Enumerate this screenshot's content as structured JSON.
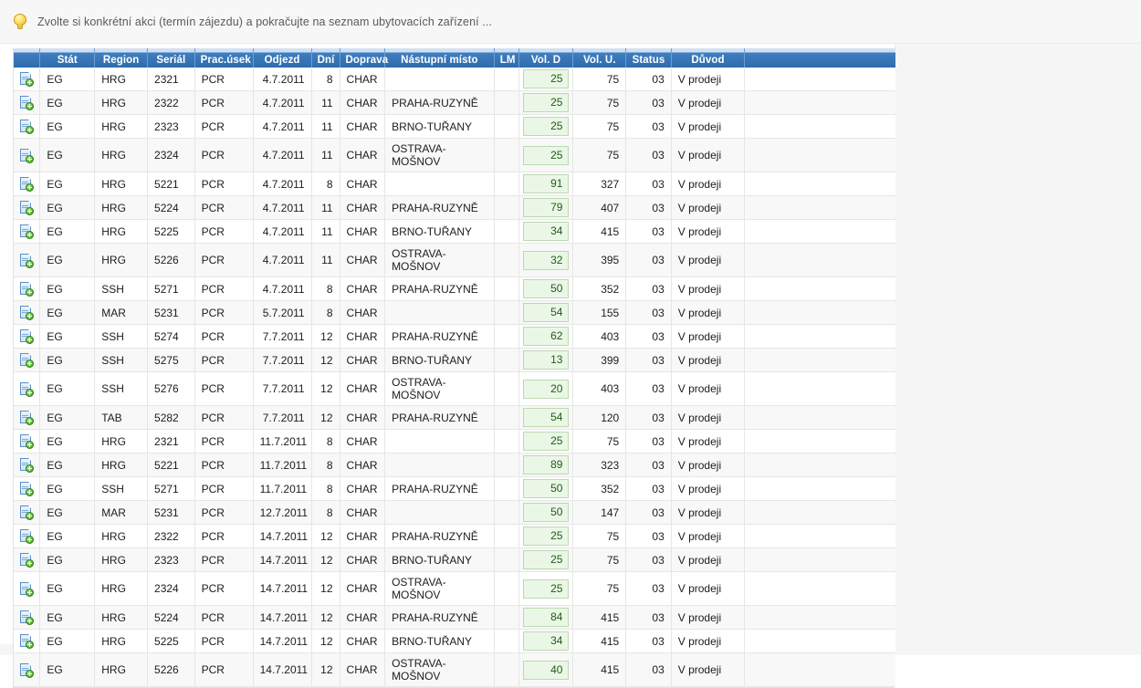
{
  "hint": {
    "icon": "lightbulb-icon",
    "text": "Zvolte si konkrétní akci (termín zájezdu) a pokračujte na seznam ubytovacích zařízení ..."
  },
  "grid": {
    "row_icon": "document-add-icon",
    "columns": [
      {
        "key": "icon",
        "label": ""
      },
      {
        "key": "stat",
        "label": "Stát"
      },
      {
        "key": "region",
        "label": "Region"
      },
      {
        "key": "serial",
        "label": "Seriál"
      },
      {
        "key": "usek",
        "label": "Prac.úsek"
      },
      {
        "key": "odjezd",
        "label": "Odjezd"
      },
      {
        "key": "dni",
        "label": "Dní"
      },
      {
        "key": "doprava",
        "label": "Doprava"
      },
      {
        "key": "nastup",
        "label": "Nástupní místo"
      },
      {
        "key": "lm",
        "label": "LM"
      },
      {
        "key": "vold",
        "label": "Vol. D"
      },
      {
        "key": "volu",
        "label": "Vol. U."
      },
      {
        "key": "status",
        "label": "Status"
      },
      {
        "key": "duvod",
        "label": "Důvod"
      },
      {
        "key": "extra",
        "label": ""
      }
    ],
    "rows": [
      {
        "stat": "EG",
        "region": "HRG",
        "serial": "2321",
        "usek": "PCR",
        "odjezd": "4.7.2011",
        "dni": "8",
        "doprava": "CHAR",
        "nastup": "",
        "lm": "",
        "vold": "25",
        "volu": "75",
        "status": "03",
        "duvod": "V prodeji",
        "extra": ""
      },
      {
        "stat": "EG",
        "region": "HRG",
        "serial": "2322",
        "usek": "PCR",
        "odjezd": "4.7.2011",
        "dni": "11",
        "doprava": "CHAR",
        "nastup": "PRAHA-RUZYNĚ",
        "lm": "",
        "vold": "25",
        "volu": "75",
        "status": "03",
        "duvod": "V prodeji",
        "extra": ""
      },
      {
        "stat": "EG",
        "region": "HRG",
        "serial": "2323",
        "usek": "PCR",
        "odjezd": "4.7.2011",
        "dni": "11",
        "doprava": "CHAR",
        "nastup": "BRNO-TUŘANY",
        "lm": "",
        "vold": "25",
        "volu": "75",
        "status": "03",
        "duvod": "V prodeji",
        "extra": ""
      },
      {
        "stat": "EG",
        "region": "HRG",
        "serial": "2324",
        "usek": "PCR",
        "odjezd": "4.7.2011",
        "dni": "11",
        "doprava": "CHAR",
        "nastup": "OSTRAVA-MOŠNOV",
        "lm": "",
        "vold": "25",
        "volu": "75",
        "status": "03",
        "duvod": "V prodeji",
        "extra": ""
      },
      {
        "stat": "EG",
        "region": "HRG",
        "serial": "5221",
        "usek": "PCR",
        "odjezd": "4.7.2011",
        "dni": "8",
        "doprava": "CHAR",
        "nastup": "",
        "lm": "",
        "vold": "91",
        "volu": "327",
        "status": "03",
        "duvod": "V prodeji",
        "extra": ""
      },
      {
        "stat": "EG",
        "region": "HRG",
        "serial": "5224",
        "usek": "PCR",
        "odjezd": "4.7.2011",
        "dni": "11",
        "doprava": "CHAR",
        "nastup": "PRAHA-RUZYNĚ",
        "lm": "",
        "vold": "79",
        "volu": "407",
        "status": "03",
        "duvod": "V prodeji",
        "extra": ""
      },
      {
        "stat": "EG",
        "region": "HRG",
        "serial": "5225",
        "usek": "PCR",
        "odjezd": "4.7.2011",
        "dni": "11",
        "doprava": "CHAR",
        "nastup": "BRNO-TUŘANY",
        "lm": "",
        "vold": "34",
        "volu": "415",
        "status": "03",
        "duvod": "V prodeji",
        "extra": ""
      },
      {
        "stat": "EG",
        "region": "HRG",
        "serial": "5226",
        "usek": "PCR",
        "odjezd": "4.7.2011",
        "dni": "11",
        "doprava": "CHAR",
        "nastup": "OSTRAVA-MOŠNOV",
        "lm": "",
        "vold": "32",
        "volu": "395",
        "status": "03",
        "duvod": "V prodeji",
        "extra": ""
      },
      {
        "stat": "EG",
        "region": "SSH",
        "serial": "5271",
        "usek": "PCR",
        "odjezd": "4.7.2011",
        "dni": "8",
        "doprava": "CHAR",
        "nastup": "PRAHA-RUZYNĚ",
        "lm": "",
        "vold": "50",
        "volu": "352",
        "status": "03",
        "duvod": "V prodeji",
        "extra": ""
      },
      {
        "stat": "EG",
        "region": "MAR",
        "serial": "5231",
        "usek": "PCR",
        "odjezd": "5.7.2011",
        "dni": "8",
        "doprava": "CHAR",
        "nastup": "",
        "lm": "",
        "vold": "54",
        "volu": "155",
        "status": "03",
        "duvod": "V prodeji",
        "extra": ""
      },
      {
        "stat": "EG",
        "region": "SSH",
        "serial": "5274",
        "usek": "PCR",
        "odjezd": "7.7.2011",
        "dni": "12",
        "doprava": "CHAR",
        "nastup": "PRAHA-RUZYNĚ",
        "lm": "",
        "vold": "62",
        "volu": "403",
        "status": "03",
        "duvod": "V prodeji",
        "extra": ""
      },
      {
        "stat": "EG",
        "region": "SSH",
        "serial": "5275",
        "usek": "PCR",
        "odjezd": "7.7.2011",
        "dni": "12",
        "doprava": "CHAR",
        "nastup": "BRNO-TUŘANY",
        "lm": "",
        "vold": "13",
        "volu": "399",
        "status": "03",
        "duvod": "V prodeji",
        "extra": ""
      },
      {
        "stat": "EG",
        "region": "SSH",
        "serial": "5276",
        "usek": "PCR",
        "odjezd": "7.7.2011",
        "dni": "12",
        "doprava": "CHAR",
        "nastup": "OSTRAVA-MOŠNOV",
        "lm": "",
        "vold": "20",
        "volu": "403",
        "status": "03",
        "duvod": "V prodeji",
        "extra": ""
      },
      {
        "stat": "EG",
        "region": "TAB",
        "serial": "5282",
        "usek": "PCR",
        "odjezd": "7.7.2011",
        "dni": "12",
        "doprava": "CHAR",
        "nastup": "PRAHA-RUZYNĚ",
        "lm": "",
        "vold": "54",
        "volu": "120",
        "status": "03",
        "duvod": "V prodeji",
        "extra": ""
      },
      {
        "stat": "EG",
        "region": "HRG",
        "serial": "2321",
        "usek": "PCR",
        "odjezd": "11.7.2011",
        "dni": "8",
        "doprava": "CHAR",
        "nastup": "",
        "lm": "",
        "vold": "25",
        "volu": "75",
        "status": "03",
        "duvod": "V prodeji",
        "extra": ""
      },
      {
        "stat": "EG",
        "region": "HRG",
        "serial": "5221",
        "usek": "PCR",
        "odjezd": "11.7.2011",
        "dni": "8",
        "doprava": "CHAR",
        "nastup": "",
        "lm": "",
        "vold": "89",
        "volu": "323",
        "status": "03",
        "duvod": "V prodeji",
        "extra": ""
      },
      {
        "stat": "EG",
        "region": "SSH",
        "serial": "5271",
        "usek": "PCR",
        "odjezd": "11.7.2011",
        "dni": "8",
        "doprava": "CHAR",
        "nastup": "PRAHA-RUZYNĚ",
        "lm": "",
        "vold": "50",
        "volu": "352",
        "status": "03",
        "duvod": "V prodeji",
        "extra": ""
      },
      {
        "stat": "EG",
        "region": "MAR",
        "serial": "5231",
        "usek": "PCR",
        "odjezd": "12.7.2011",
        "dni": "8",
        "doprava": "CHAR",
        "nastup": "",
        "lm": "",
        "vold": "50",
        "volu": "147",
        "status": "03",
        "duvod": "V prodeji",
        "extra": ""
      },
      {
        "stat": "EG",
        "region": "HRG",
        "serial": "2322",
        "usek": "PCR",
        "odjezd": "14.7.2011",
        "dni": "12",
        "doprava": "CHAR",
        "nastup": "PRAHA-RUZYNĚ",
        "lm": "",
        "vold": "25",
        "volu": "75",
        "status": "03",
        "duvod": "V prodeji",
        "extra": ""
      },
      {
        "stat": "EG",
        "region": "HRG",
        "serial": "2323",
        "usek": "PCR",
        "odjezd": "14.7.2011",
        "dni": "12",
        "doprava": "CHAR",
        "nastup": "BRNO-TUŘANY",
        "lm": "",
        "vold": "25",
        "volu": "75",
        "status": "03",
        "duvod": "V prodeji",
        "extra": ""
      },
      {
        "stat": "EG",
        "region": "HRG",
        "serial": "2324",
        "usek": "PCR",
        "odjezd": "14.7.2011",
        "dni": "12",
        "doprava": "CHAR",
        "nastup": "OSTRAVA-MOŠNOV",
        "lm": "",
        "vold": "25",
        "volu": "75",
        "status": "03",
        "duvod": "V prodeji",
        "extra": ""
      },
      {
        "stat": "EG",
        "region": "HRG",
        "serial": "5224",
        "usek": "PCR",
        "odjezd": "14.7.2011",
        "dni": "12",
        "doprava": "CHAR",
        "nastup": "PRAHA-RUZYNĚ",
        "lm": "",
        "vold": "84",
        "volu": "415",
        "status": "03",
        "duvod": "V prodeji",
        "extra": ""
      },
      {
        "stat": "EG",
        "region": "HRG",
        "serial": "5225",
        "usek": "PCR",
        "odjezd": "14.7.2011",
        "dni": "12",
        "doprava": "CHAR",
        "nastup": "BRNO-TUŘANY",
        "lm": "",
        "vold": "34",
        "volu": "415",
        "status": "03",
        "duvod": "V prodeji",
        "extra": ""
      },
      {
        "stat": "EG",
        "region": "HRG",
        "serial": "5226",
        "usek": "PCR",
        "odjezd": "14.7.2011",
        "dni": "12",
        "doprava": "CHAR",
        "nastup": "OSTRAVA-MOŠNOV",
        "lm": "",
        "vold": "40",
        "volu": "415",
        "status": "03",
        "duvod": "V prodeji",
        "extra": ""
      }
    ]
  },
  "colors": {
    "header_blue": "#3876b8",
    "header_top_strip": "#cfe0f2",
    "vold_bg": "#eaf7e6",
    "vold_border": "#bcd9b0",
    "vold_text": "#24591a",
    "page_bg": "#f5f5f5",
    "hint_bg": "#f7f7f7"
  }
}
